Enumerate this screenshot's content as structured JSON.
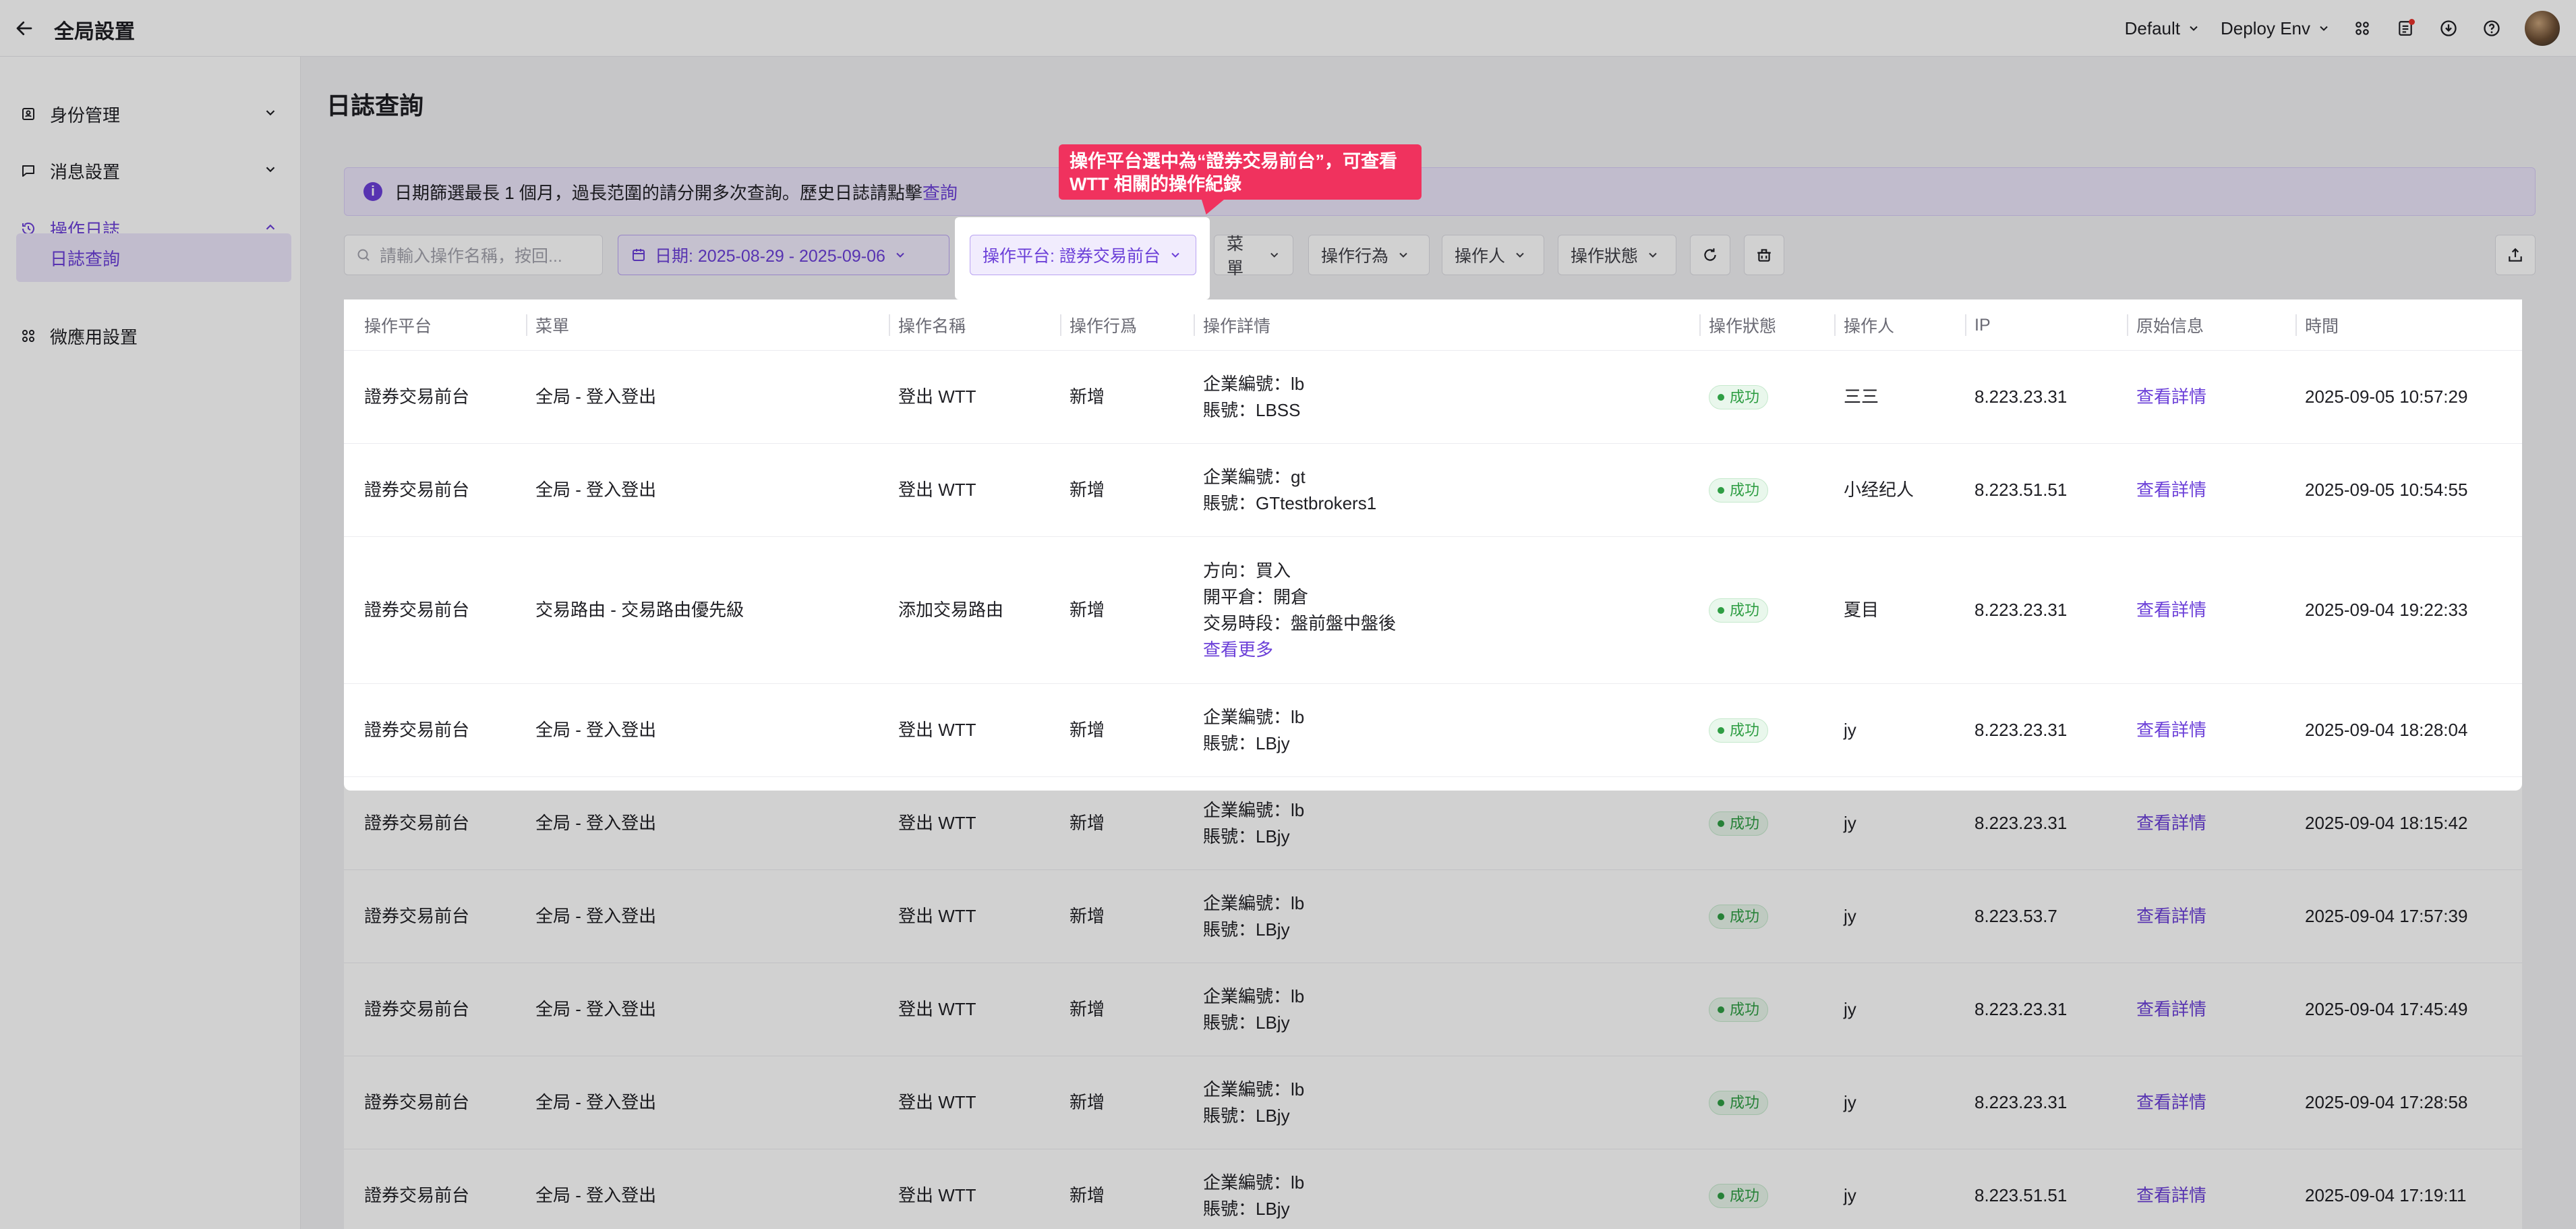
{
  "header": {
    "title": "全局設置",
    "env_selector": "Default",
    "deploy_env": "Deploy Env"
  },
  "sidebar": {
    "items": [
      {
        "label": "身份管理",
        "icon": "id-card-icon"
      },
      {
        "label": "消息設置",
        "icon": "message-icon"
      },
      {
        "label": "操作日誌",
        "icon": "history-icon"
      },
      {
        "label": "微應用設置",
        "icon": "apps-icon"
      }
    ],
    "sub_item": "日誌查詢"
  },
  "main": {
    "page_title": "日誌查詢",
    "banner_text": "日期篩選最長 1 個月，過長范圍的請分開多次查詢。歷史日誌請點擊",
    "banner_link": "查詢",
    "search_placeholder": "請輸入操作名稱，按回...",
    "filters": {
      "date": "日期: 2025-08-29 - 2025-09-06",
      "platform": "操作平台: 證券交易前台",
      "menu": "菜單",
      "action": "操作行為",
      "operator": "操作人",
      "status": "操作狀態"
    }
  },
  "callout": {
    "line1": "操作平台選中為“證券交易前台”，可查看",
    "line2": "WTT 相關的操作紀錄"
  },
  "table": {
    "headers": [
      "操作平台",
      "菜單",
      "操作名稱",
      "操作行爲",
      "操作詳情",
      "操作狀態",
      "操作人",
      "IP",
      "原始信息",
      "時間"
    ],
    "rows": [
      {
        "platform": "證券交易前台",
        "menu": "全局 - 登入登出",
        "name": "登出 WTT",
        "action": "新增",
        "details": [
          "企業編號：lb",
          "賬號：LBSS"
        ],
        "more": "",
        "status": "成功",
        "operator": "三三",
        "ip": "8.223.23.31",
        "raw": "查看詳情",
        "time": "2025-09-05 10:57:29"
      },
      {
        "platform": "證券交易前台",
        "menu": "全局 - 登入登出",
        "name": "登出 WTT",
        "action": "新增",
        "details": [
          "企業編號：gt",
          "賬號：GTtestbrokers1"
        ],
        "more": "",
        "status": "成功",
        "operator": "小经纪人",
        "ip": "8.223.51.51",
        "raw": "查看詳情",
        "time": "2025-09-05 10:54:55"
      },
      {
        "platform": "證券交易前台",
        "menu": "交易路由 - 交易路由優先級",
        "name": "添加交易路由",
        "action": "新增",
        "details": [
          "方向：買入",
          "開平倉：開倉",
          "交易時段：盤前盤中盤後"
        ],
        "more": "查看更多",
        "status": "成功",
        "operator": "夏目",
        "ip": "8.223.23.31",
        "raw": "查看詳情",
        "time": "2025-09-04 19:22:33"
      },
      {
        "platform": "證券交易前台",
        "menu": "全局 - 登入登出",
        "name": "登出 WTT",
        "action": "新增",
        "details": [
          "企業編號：lb",
          "賬號：LBjy"
        ],
        "more": "",
        "status": "成功",
        "operator": "jy",
        "ip": "8.223.23.31",
        "raw": "查看詳情",
        "time": "2025-09-04 18:28:04"
      },
      {
        "platform": "證券交易前台",
        "menu": "全局 - 登入登出",
        "name": "登出 WTT",
        "action": "新增",
        "details": [
          "企業編號：lb",
          "賬號：LBjy"
        ],
        "more": "",
        "status": "成功",
        "operator": "jy",
        "ip": "8.223.23.31",
        "raw": "查看詳情",
        "time": "2025-09-04 18:15:42"
      },
      {
        "platform": "證券交易前台",
        "menu": "全局 - 登入登出",
        "name": "登出 WTT",
        "action": "新增",
        "details": [
          "企業編號：lb",
          "賬號：LBjy"
        ],
        "more": "",
        "status": "成功",
        "operator": "jy",
        "ip": "8.223.53.7",
        "raw": "查看詳情",
        "time": "2025-09-04 17:57:39"
      },
      {
        "platform": "證券交易前台",
        "menu": "全局 - 登入登出",
        "name": "登出 WTT",
        "action": "新增",
        "details": [
          "企業編號：lb",
          "賬號：LBjy"
        ],
        "more": "",
        "status": "成功",
        "operator": "jy",
        "ip": "8.223.23.31",
        "raw": "查看詳情",
        "time": "2025-09-04 17:45:49"
      },
      {
        "platform": "證券交易前台",
        "menu": "全局 - 登入登出",
        "name": "登出 WTT",
        "action": "新增",
        "details": [
          "企業編號：lb",
          "賬號：LBjy"
        ],
        "more": "",
        "status": "成功",
        "operator": "jy",
        "ip": "8.223.23.31",
        "raw": "查看詳情",
        "time": "2025-09-04 17:28:58"
      },
      {
        "platform": "證券交易前台",
        "menu": "全局 - 登入登出",
        "name": "登出 WTT",
        "action": "新增",
        "details": [
          "企業編號：lb",
          "賬號：LBjy"
        ],
        "more": "",
        "status": "成功",
        "operator": "jy",
        "ip": "8.223.51.51",
        "raw": "查看詳情",
        "time": "2025-09-04 17:19:11"
      }
    ]
  },
  "colors": {
    "accent": "#6b3fd8",
    "success": "#2f9e44",
    "callout": "#f0325e"
  }
}
